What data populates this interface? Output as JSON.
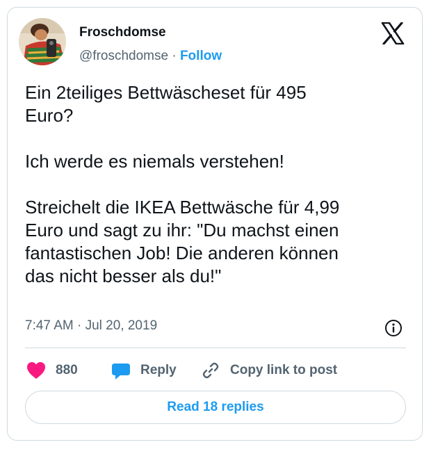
{
  "author": {
    "name": "Froschdomse",
    "handle": "@froschdomse",
    "separator": "·",
    "follow_label": "Follow"
  },
  "icons": {
    "brand": "x-logo-icon",
    "info": "info-icon",
    "like": "heart-icon",
    "reply": "speech-bubble-icon",
    "copy": "link-icon"
  },
  "post": {
    "text": "Ein 2teiliges Bettwäscheset für 495\nEuro?\n\nIch werde es niemals verstehen!\n\nStreichelt die IKEA Bettwäsche für 4,99\nEuro und sagt zu ihr: \"Du machst einen\nfantastischen Job! Die anderen können\ndas nicht besser als du!\"",
    "time": "7:47 AM",
    "separator": "·",
    "date": "Jul 20, 2019"
  },
  "actions": {
    "like_count": "880",
    "reply_label": "Reply",
    "copy_label": "Copy link to post"
  },
  "read_replies_label": "Read 18 replies",
  "colors": {
    "accent": "#1d9bf0",
    "like": "#f91880",
    "text": "#0f1419",
    "secondary": "#536471",
    "border": "#cfd9de"
  }
}
